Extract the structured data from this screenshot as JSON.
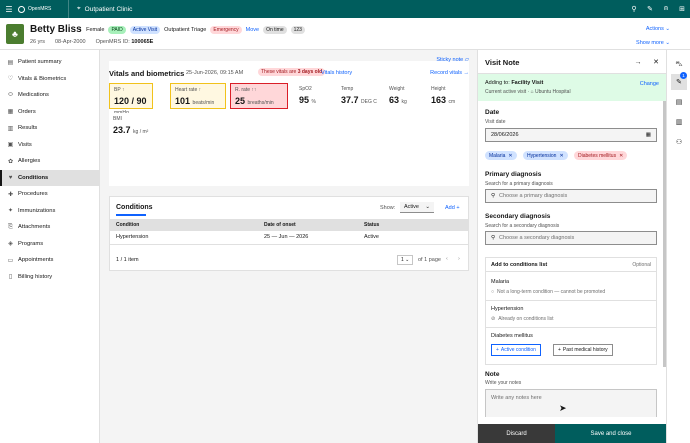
{
  "topbar": {
    "logo": "OpenMRS",
    "location": "Outpatient Clinic",
    "icons": [
      "search-icon",
      "pen-icon",
      "user-icon",
      "grid-icon"
    ]
  },
  "patient": {
    "name": "Betty Bliss",
    "gender": "Female",
    "tag_paid": "PAID",
    "tag_active_visit": "Active Visit",
    "triage": "Outpatient Triage",
    "tag_emergency": "Emergency",
    "move": "Move",
    "tag_ontime": "On time",
    "tag_count": "123",
    "age": "26 yrs",
    "dob": "08-Apr-2000",
    "id_label": "OpenMRS ID:",
    "id_value": "100065E",
    "actions": "Actions",
    "show_more": "Show more"
  },
  "leftnav": [
    {
      "label": "Patient summary",
      "icon": "summary-icon"
    },
    {
      "label": "Vitals & Biometrics",
      "icon": "vitals-icon"
    },
    {
      "label": "Medications",
      "icon": "pill-icon"
    },
    {
      "label": "Orders",
      "icon": "orders-icon"
    },
    {
      "label": "Results",
      "icon": "results-icon"
    },
    {
      "label": "Visits",
      "icon": "visits-icon"
    },
    {
      "label": "Allergies",
      "icon": "allergies-icon"
    },
    {
      "label": "Conditions",
      "icon": "conditions-icon",
      "active": true
    },
    {
      "label": "Procedures",
      "icon": "procedures-icon"
    },
    {
      "label": "Immunizations",
      "icon": "immunizations-icon"
    },
    {
      "label": "Attachments",
      "icon": "attachment-icon"
    },
    {
      "label": "Programs",
      "icon": "programs-icon"
    },
    {
      "label": "Appointments",
      "icon": "calendar-icon"
    },
    {
      "label": "Billing history",
      "icon": "billing-icon"
    }
  ],
  "vitals": {
    "title": "Vitals and biometrics",
    "date": "25-Jun-2026, 09:15 AM",
    "old_badge_pre": "These vitals are ",
    "old_badge_bold": "3 days old",
    "history_link": "Vitals history",
    "sticky_note": "Sticky note",
    "record": "Record vitals",
    "tiles": [
      {
        "label": "BP ↑",
        "value": "120 / 90",
        "unit": "mmHg",
        "status": "warn"
      },
      {
        "label": "Heart rate ↑",
        "value": "101",
        "unit": "beats/min",
        "status": "warn"
      },
      {
        "label": "R. rate ↑↑",
        "value": "25",
        "unit": "breaths/min",
        "status": "crit"
      },
      {
        "label": "SpO2",
        "value": "95",
        "unit": "%",
        "status": "plain"
      },
      {
        "label": "Temp",
        "value": "37.7",
        "unit": "DEG C",
        "status": "plain"
      },
      {
        "label": "Weight",
        "value": "63",
        "unit": "kg",
        "status": "plain"
      },
      {
        "label": "Height",
        "value": "163",
        "unit": "cm",
        "status": "plain"
      },
      {
        "label": "BMI",
        "value": "23.7",
        "unit": "kg / m²",
        "status": "plain"
      }
    ]
  },
  "conditions": {
    "title": "Conditions",
    "show_label": "Show:",
    "filter_value": "Active",
    "add": "Add",
    "columns": [
      "Condition",
      "Date of onset",
      "Status"
    ],
    "rows": [
      {
        "condition": "Hypertension",
        "onset": "25 — Jun — 2026",
        "status": "Active"
      }
    ],
    "items_count": "1 / 1 item",
    "page_value": "1",
    "page_of": "of 1 page"
  },
  "visit_note": {
    "title": "Visit Note",
    "adding_to_label": "Adding to:",
    "adding_to_value": "Facility Visit",
    "current_visit": "Current active visit",
    "hospital": "Ubuntu Hospital",
    "change": "Change",
    "date_title": "Date",
    "date_sub": "Visit date",
    "date_value": "28/06/2026",
    "chips": [
      {
        "label": "Malaria",
        "color": "blue"
      },
      {
        "label": "Hypertension",
        "color": "blue"
      },
      {
        "label": "Diabetes mellitus",
        "color": "red"
      }
    ],
    "primary_title": "Primary diagnosis",
    "primary_sub": "Search for a primary diagnosis",
    "primary_placeholder": "Choose a primary diagnosis",
    "secondary_title": "Secondary diagnosis",
    "secondary_sub": "Search for a secondary diagnosis",
    "secondary_placeholder": "Choose a secondary diagnosis",
    "cl_title": "Add to conditions list",
    "cl_optional": "Optional",
    "cl_items": [
      {
        "name": "Malaria",
        "note": "Not a long-term condition — cannot be promoted"
      },
      {
        "name": "Hypertension",
        "note": "Already on conditions list"
      },
      {
        "name": "Diabetes mellitus"
      }
    ],
    "btn_active": "Active condition",
    "btn_past": "Past medical history",
    "note_title": "Note",
    "note_sub": "Write your notes",
    "note_placeholder": "Write any notes here",
    "discard": "Discard",
    "save": "Save and close"
  },
  "rail": {
    "badge": "1"
  },
  "colors": {
    "brand": "#005d5d",
    "link": "#0f62fe",
    "success_bg": "#defbe6"
  }
}
